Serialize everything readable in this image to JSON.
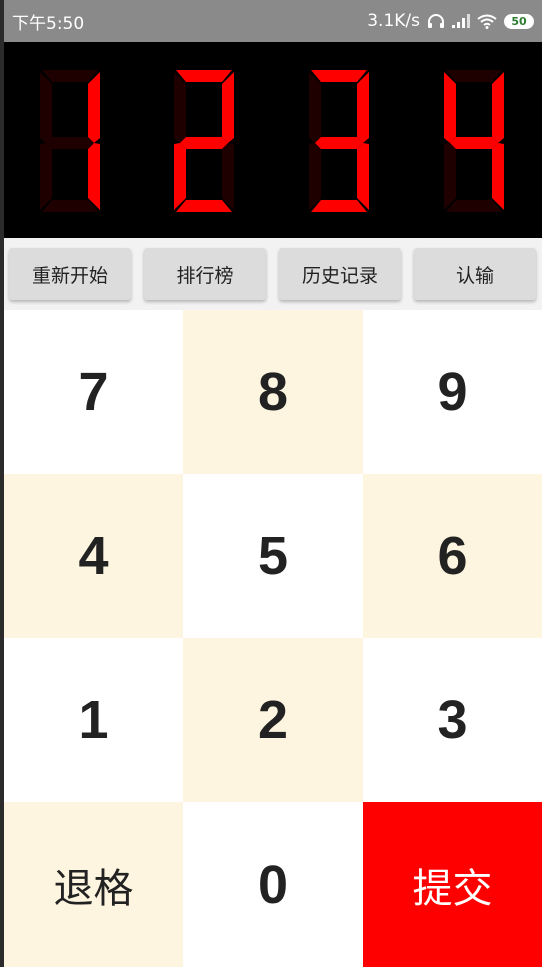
{
  "status_bar": {
    "time": "下午5:50",
    "net_speed": "3.1K/s",
    "battery_level": "50",
    "icons": [
      "headphones-icon",
      "signal-icon",
      "wifi-icon",
      "battery-icon"
    ]
  },
  "display": {
    "digits": [
      "1",
      "2",
      "3",
      "4"
    ],
    "on_color": "#ff0000",
    "off_color": "#1e0000"
  },
  "actions": {
    "restart": "重新开始",
    "leaderboard": "排行榜",
    "history": "历史记录",
    "give_up": "认输"
  },
  "keypad": {
    "k7": "7",
    "k8": "8",
    "k9": "9",
    "k4": "4",
    "k5": "5",
    "k6": "6",
    "k1": "1",
    "k2": "2",
    "k3": "3",
    "backspace": "退格",
    "k0": "0",
    "submit": "提交"
  },
  "colors": {
    "keypad_cream": "#fdf5df",
    "submit_red": "#ff0000"
  }
}
